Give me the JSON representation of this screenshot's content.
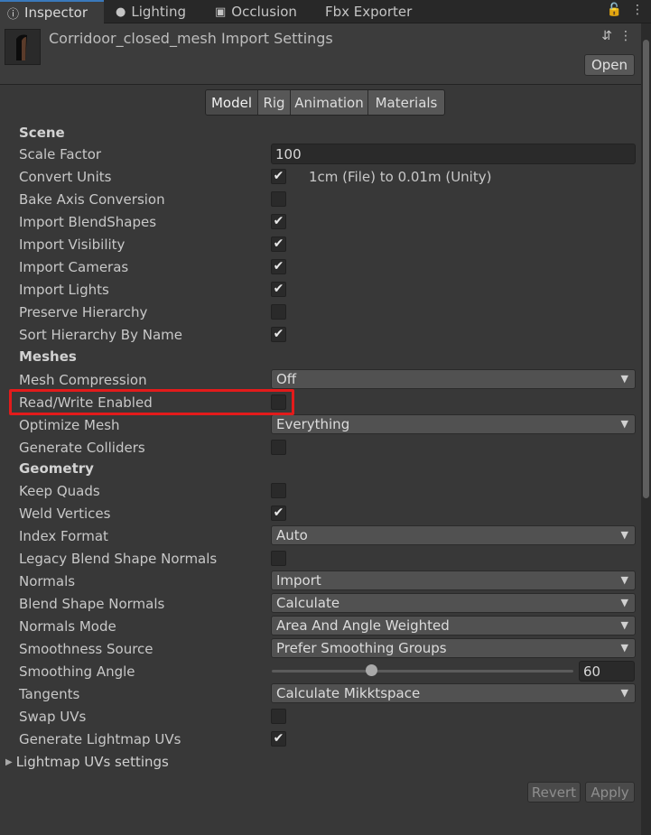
{
  "tabs": [
    {
      "label": "Inspector",
      "icon": "info-icon"
    },
    {
      "label": "Lighting",
      "icon": "bulb-icon"
    },
    {
      "label": "Occlusion",
      "icon": "occlusion-icon"
    },
    {
      "label": "Fbx Exporter",
      "icon": ""
    }
  ],
  "header": {
    "title": "Corridoor_closed_mesh Import Settings",
    "open_label": "Open"
  },
  "segments": [
    "Model",
    "Rig",
    "Animation",
    "Materials"
  ],
  "sections": {
    "scene": "Scene",
    "meshes": "Meshes",
    "geometry": "Geometry"
  },
  "fields": {
    "scale_factor": {
      "label": "Scale Factor",
      "value": "100"
    },
    "convert_units": {
      "label": "Convert Units",
      "checked": true,
      "note": "1cm (File) to 0.01m (Unity)"
    },
    "bake_axis": {
      "label": "Bake Axis Conversion",
      "checked": false
    },
    "import_blendshapes": {
      "label": "Import BlendShapes",
      "checked": true
    },
    "import_visibility": {
      "label": "Import Visibility",
      "checked": true
    },
    "import_cameras": {
      "label": "Import Cameras",
      "checked": true
    },
    "import_lights": {
      "label": "Import Lights",
      "checked": true
    },
    "preserve_hierarchy": {
      "label": "Preserve Hierarchy",
      "checked": false
    },
    "sort_hierarchy": {
      "label": "Sort Hierarchy By Name",
      "checked": true
    },
    "mesh_compression": {
      "label": "Mesh Compression",
      "value": "Off"
    },
    "read_write": {
      "label": "Read/Write Enabled",
      "checked": false
    },
    "optimize_mesh": {
      "label": "Optimize Mesh",
      "value": "Everything"
    },
    "generate_colliders": {
      "label": "Generate Colliders",
      "checked": false
    },
    "keep_quads": {
      "label": "Keep Quads",
      "checked": false
    },
    "weld_vertices": {
      "label": "Weld Vertices",
      "checked": true
    },
    "index_format": {
      "label": "Index Format",
      "value": "Auto"
    },
    "legacy_blend": {
      "label": "Legacy Blend Shape Normals",
      "checked": false
    },
    "normals": {
      "label": "Normals",
      "value": "Import"
    },
    "blend_shape_normals": {
      "label": "Blend Shape Normals",
      "value": "Calculate"
    },
    "normals_mode": {
      "label": "Normals Mode",
      "value": "Area And Angle Weighted"
    },
    "smoothness_source": {
      "label": "Smoothness Source",
      "value": "Prefer Smoothing Groups"
    },
    "smoothing_angle": {
      "label": "Smoothing Angle",
      "value": "60",
      "fraction": 0.33
    },
    "tangents": {
      "label": "Tangents",
      "value": "Calculate Mikktspace"
    },
    "swap_uvs": {
      "label": "Swap UVs",
      "checked": false
    },
    "generate_lightmap_uvs": {
      "label": "Generate Lightmap UVs",
      "checked": true
    }
  },
  "foldout": {
    "label": "Lightmap UVs settings"
  },
  "footer": {
    "revert_label": "Revert",
    "apply_label": "Apply"
  },
  "colors": {
    "highlight": "#e31b1b",
    "accent": "#3a79bb"
  }
}
